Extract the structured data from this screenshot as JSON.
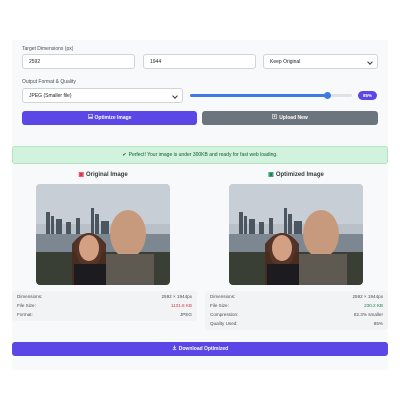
{
  "dimensions": {
    "label": "Target Dimensions (px)",
    "width_value": "2592",
    "height_value": "1944",
    "aspect_select": "Keep Original"
  },
  "format": {
    "label": "Output Format & Quality",
    "format_select": "JPEG (Smaller file)",
    "quality_value": 85,
    "quality_label": "85%"
  },
  "actions": {
    "optimize_label": "Optimize Image",
    "upload_label": "Upload New"
  },
  "alert": {
    "message": "Perfect! Your image is under 300KB and ready for fast web loading."
  },
  "original": {
    "title": "Original Image",
    "rows": [
      {
        "key": "Dimensions:",
        "value": "2592 × 1944px"
      },
      {
        "key": "File Size:",
        "value": "1131.8 KB"
      },
      {
        "key": "Format:",
        "value": "JPEG"
      }
    ]
  },
  "optimized": {
    "title": "Optimized Image",
    "rows": [
      {
        "key": "Dimensions:",
        "value": "2592 × 1944px"
      },
      {
        "key": "File Size:",
        "value": "230.2 KB"
      },
      {
        "key": "Compression:",
        "value": "82.3% smaller"
      },
      {
        "key": "Quality Used:",
        "value": "85%"
      }
    ]
  },
  "download_label": "Download Optimized",
  "colors": {
    "primary": "#5a47e6",
    "secondary": "#6c757d",
    "success_bg": "#d1f2dc",
    "danger": "#dc3545",
    "success": "#198754",
    "slider": "#3d7be0"
  }
}
